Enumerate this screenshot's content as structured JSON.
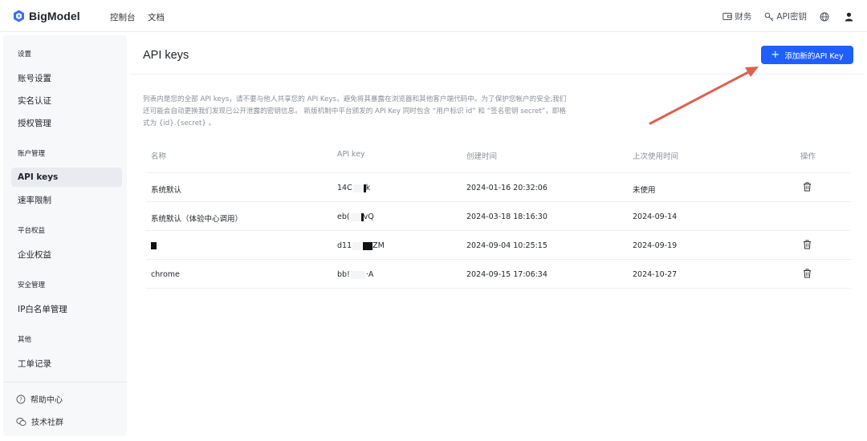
{
  "header": {
    "brand": "BigModel",
    "nav": [
      "控制台",
      "文档"
    ],
    "finance": "财务",
    "api_key_menu": "API密钥"
  },
  "sidebar": {
    "groups": [
      {
        "title": "设置",
        "items": [
          "账号设置",
          "实名认证",
          "授权管理"
        ]
      },
      {
        "title": "账户管理",
        "items": [
          "API keys",
          "速率限制"
        ]
      },
      {
        "title": "平台权益",
        "items": [
          "企业权益"
        ]
      },
      {
        "title": "安全管理",
        "items": [
          "IP白名单管理"
        ]
      },
      {
        "title": "其他",
        "items": [
          "工单记录"
        ]
      }
    ],
    "active": "API keys",
    "footer": [
      "帮助中心",
      "技术社群"
    ]
  },
  "main": {
    "title": "API keys",
    "add_button": "添加新的API Key",
    "description": "列表内是您的全部 API keys，请不要与他人共享您的 API Keys，避免将其暴露在浏览器和其他客户端代码中。为了保护您帐户的安全,我们还可能会自动更换我们发现已公开泄露的密钥信息。 新版机制中平台颁发的 API Key 同时包含 “用户标识 id” 和 “签名密钥 secret”，即格式为 {id}.{secret} 。",
    "columns": [
      "名称",
      "API key",
      "创建时间",
      "上次使用时间",
      "操作"
    ],
    "rows": [
      {
        "name": "系统默认",
        "key_start": "14C",
        "key_end": "k",
        "created": "2024-01-16 20:32:06",
        "last_used": "未使用",
        "deletable": true
      },
      {
        "name": "系统默认（体验中心调用）",
        "key_start": "eb(",
        "key_end": "vQ",
        "created": "2024-03-18 18:16:30",
        "last_used": "2024-09-14",
        "deletable": false
      },
      {
        "name": "",
        "key_start": "d11",
        "key_end": "ZM",
        "created": "2024-09-04 10:25:15",
        "last_used": "2024-09-19",
        "deletable": true
      },
      {
        "name": "chrome",
        "key_start": "bb!",
        "key_end": "·A",
        "created": "2024-09-15 17:06:34",
        "last_used": "2024-10-27",
        "deletable": true
      }
    ]
  },
  "colors": {
    "accent": "#1f5fff",
    "annotation_arrow": "#e0604f"
  },
  "icons": [
    "logo-cube-icon",
    "wallet-icon",
    "key-icon",
    "globe-icon",
    "user-icon",
    "help-circle-icon",
    "chat-icon",
    "trash-icon",
    "plus-icon"
  ]
}
